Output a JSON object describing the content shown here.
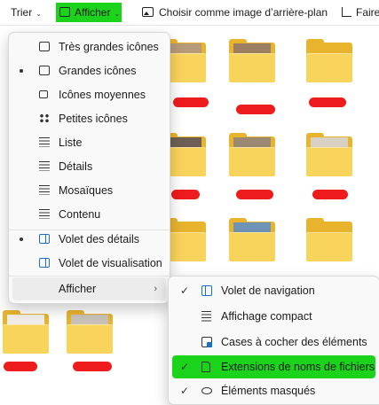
{
  "toolbar": {
    "sort_label": "Trier",
    "view_label": "Afficher",
    "background_label": "Choisir comme image d’arrière-plan",
    "share_label": "Faire"
  },
  "view_menu": {
    "items": [
      {
        "label": "Très grandes icônes",
        "icon": "monitor-icon",
        "selected": false
      },
      {
        "label": "Grandes icônes",
        "icon": "monitor-icon",
        "selected": true
      },
      {
        "label": "Icônes moyennes",
        "icon": "monitor-small-icon",
        "selected": false
      },
      {
        "label": "Petites icônes",
        "icon": "small-icons-icon",
        "selected": false
      },
      {
        "label": "Liste",
        "icon": "list-icon",
        "selected": false
      },
      {
        "label": "Détails",
        "icon": "details-icon",
        "selected": false
      },
      {
        "label": "Mosaïques",
        "icon": "tiles-icon",
        "selected": false
      },
      {
        "label": "Contenu",
        "icon": "content-icon",
        "selected": false
      },
      {
        "label": "Volet des détails",
        "icon": "details-pane-icon",
        "selected": true
      },
      {
        "label": "Volet de visualisation",
        "icon": "preview-pane-icon",
        "selected": false
      }
    ],
    "show_label": "Afficher"
  },
  "show_submenu": {
    "items": [
      {
        "label": "Volet de navigation",
        "checked": true,
        "icon": "navigation-pane-icon"
      },
      {
        "label": "Affichage compact",
        "checked": false,
        "icon": "compact-view-icon"
      },
      {
        "label": "Cases à cocher des éléments",
        "checked": false,
        "icon": "checkbox-icon"
      },
      {
        "label": "Extensions de noms de fichiers",
        "checked": true,
        "icon": "file-extension-icon",
        "highlighted": true
      },
      {
        "label": "Éléments masqués",
        "checked": true,
        "icon": "eye-icon"
      }
    ],
    "check_glyph": "✓"
  },
  "colors": {
    "highlight": "#1bd31b",
    "redaction": "#ee1c1c",
    "folder": "#f9d45c"
  }
}
